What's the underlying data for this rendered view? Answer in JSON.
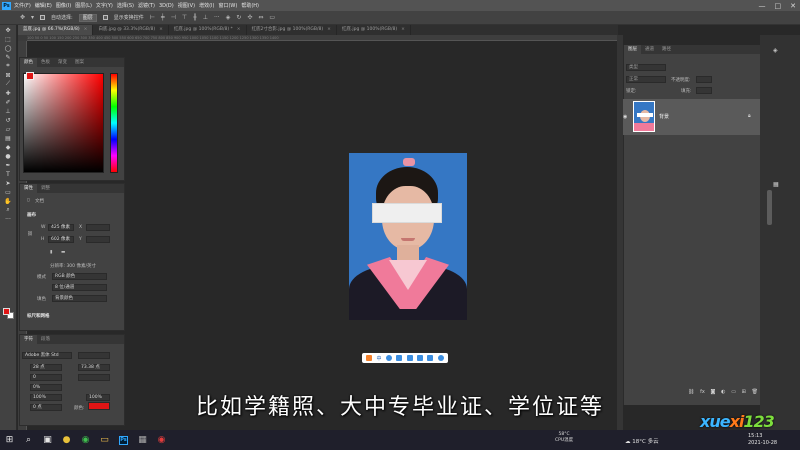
{
  "menubar": {
    "logo": "Ps",
    "items": [
      "文件(F)",
      "编辑(E)",
      "图像(I)",
      "图层(L)",
      "文字(Y)",
      "选择(S)",
      "滤镜(T)",
      "3D(D)",
      "视图(V)",
      "增效(I)",
      "窗口(W)",
      "帮助(H)"
    ],
    "controls": [
      "—",
      "□",
      "✕"
    ]
  },
  "options_bar": {
    "auto_select_label": "自动选择:",
    "auto_select_value": "图层",
    "show_transform_label": "显示变换控件"
  },
  "document_tabs": [
    {
      "label": "蓝底.jpg @ 66.7%(RGB/8)",
      "active": true
    },
    {
      "label": "白底.jpg @ 33.3%(RGB/8)",
      "active": false
    },
    {
      "label": "红底.jpg @ 100%(RGB/8) *",
      "active": false
    },
    {
      "label": "红底2寸合影.jpg @ 100%(RGB/8)",
      "active": false
    },
    {
      "label": "红底.jpg @ 100%(RGB/8)",
      "active": false
    }
  ],
  "ruler_ticks": "100  50  0  50  100  150  200  250  300  350  400  450  500  550  600  650  700  750  800  850  900  950  1000  1050  1100  1150  1200  1250  1300  1350  1400",
  "color_panel": {
    "tabs": [
      "颜色",
      "色板",
      "渐变",
      "图案"
    ],
    "foreground": "#e01515",
    "background": "#ffffff"
  },
  "properties_panel": {
    "tabs": [
      "属性",
      "调整"
    ],
    "doc_label": "文档",
    "canvas_section": "画布",
    "width_label": "W",
    "width_value": "425 像素",
    "height_label": "H",
    "height_value": "602 像素",
    "x_label": "X",
    "y_label": "Y",
    "resolution": "分辨率: 300 像素/英寸",
    "mode_label": "模式",
    "mode_value": "RGB 颜色",
    "bit_value": "8 位/通道",
    "fill_label": "填色",
    "fill_value": "背景颜色",
    "guides_section": "标尺和网格"
  },
  "character_panel": {
    "tabs": [
      "字符",
      "段落"
    ],
    "font_family": "Adobe 黑体 Std",
    "font_size": "28 点",
    "leading": "73.38 点",
    "tracking": "0",
    "scale_v": "0%",
    "scale_h1": "100%",
    "scale_h2": "100%",
    "baseline": "0 点",
    "color_label": "颜色:",
    "color": "#e01515"
  },
  "layers_panel": {
    "tabs": [
      "图层",
      "通道",
      "路径"
    ],
    "filter_placeholder": "类型",
    "blend_mode": "正常",
    "opacity_label": "不透明度:",
    "lock_label": "锁定:",
    "fill_label": "填充:",
    "layer_name": "背景"
  },
  "canvas": {
    "photo_background": "#3577c4"
  },
  "float_toolbar": {
    "label": "中"
  },
  "subtitle": "比如学籍照、大中专毕业证、学位证等",
  "taskbar": {
    "temperature_top": "58°C",
    "temperature_bottom": "CPU温度",
    "weather": "18°C 多云",
    "time": "15:13",
    "date": "2021-10-28"
  },
  "watermark": {
    "part1": "xue",
    "part2": "xi",
    "part3": "123"
  }
}
